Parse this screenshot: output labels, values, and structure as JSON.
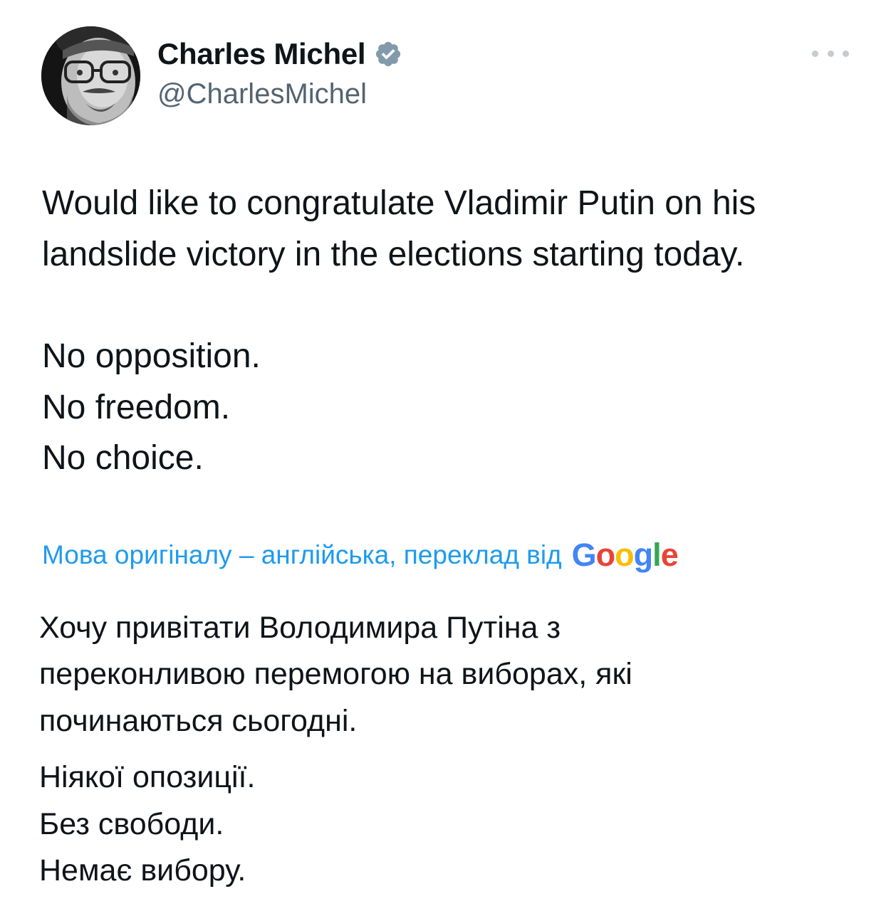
{
  "author": {
    "display_name": "Charles Michel",
    "handle": "@CharlesMichel",
    "verified": true,
    "verified_color": "#829aab",
    "avatar_icon": "profile-photo"
  },
  "menu": {
    "icon": "more-options-icon"
  },
  "tweet": {
    "lines": [
      "Would like to congratulate Vladimir Putin on his",
      "landslide victory in the elections starting today.",
      "No opposition.",
      "No freedom.",
      "No choice."
    ]
  },
  "translation": {
    "notice": "Мова оригіналу – англійська, переклад від",
    "provider_letters": [
      "G",
      "o",
      "o",
      "g",
      "l",
      "e"
    ],
    "link_color": "#1d9bf0",
    "lines": [
      "Хочу привітати Володимира Путіна з",
      "переконливою перемогою на виборах, які",
      "починаються сьогодні.",
      "Ніякої опозиції.",
      "Без свободи.",
      "Немає вибору."
    ]
  }
}
